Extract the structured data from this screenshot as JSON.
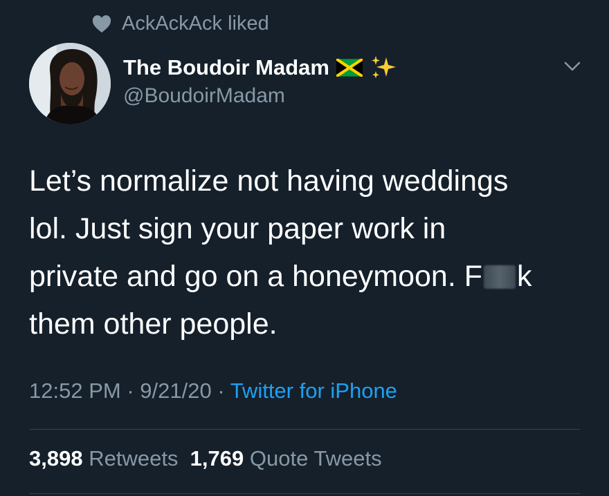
{
  "social_context": {
    "text": "AckAckAck liked",
    "icon": "heart-icon"
  },
  "author": {
    "name": "The Boudoir Madam",
    "handle": "@BoudoirMadam",
    "name_emojis": [
      "jamaica-flag-icon",
      "sparkles-icon"
    ]
  },
  "tweet": {
    "lines": [
      "Let’s normalize not having weddings",
      "lol. Just sign your paper work in",
      "private and go on a honeymoon. F",
      "them other people."
    ],
    "line3_tail": "k"
  },
  "meta": {
    "time": "12:52 PM",
    "sep1": " · ",
    "date": "9/21/20",
    "sep2": " · ",
    "source": "Twitter for iPhone"
  },
  "stats": {
    "retweets_count": "3,898",
    "retweets_label": "Retweets",
    "quotes_count": "1,769",
    "quotes_label": "Quote Tweets"
  },
  "colors": {
    "background": "#15202b",
    "secondary_text": "#8899a6",
    "link": "#1da1f2",
    "divider": "#38444d"
  }
}
